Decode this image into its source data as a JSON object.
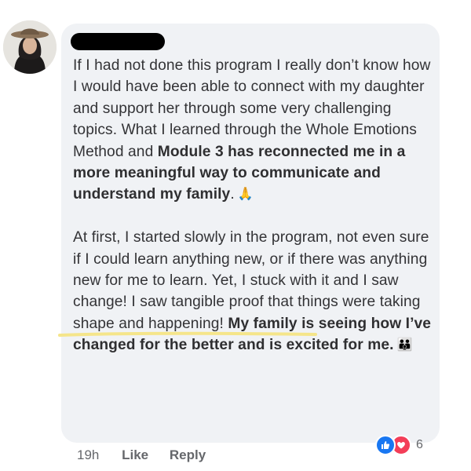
{
  "comment": {
    "p1_a": "If I had not done this program I really don’t know how I would have been able to connect with my daughter and support her through some very challenging topics. What I learned through the Whole Emotions Method and ",
    "p1_bold": "Module 3 has reconnected me in a more meaningful way to communicate and understand my family",
    "p1_end": ".",
    "p1_emoji": "🙏",
    "p2_a": "At first, I started slowly in the program, not even sure if I could learn anything new, or if there was anything new for me to learn. Yet, I stuck with it and I saw change! I saw tangible proof that things were taking shape and happening! ",
    "p2_bold": "My family is seeing how I’ve changed for the better and is excited for me.",
    "p2_emoji": "👪"
  },
  "actions": {
    "time": "19h",
    "like": "Like",
    "reply": "Reply"
  },
  "reactions": {
    "icons": [
      "like-icon",
      "love-icon"
    ],
    "count": "6"
  },
  "colors": {
    "bubble": "#f0f2f5",
    "text": "#333336",
    "meta": "#65676b",
    "like": "#1877f2",
    "love": "#f33e58",
    "highlight": "#f5e58a"
  }
}
